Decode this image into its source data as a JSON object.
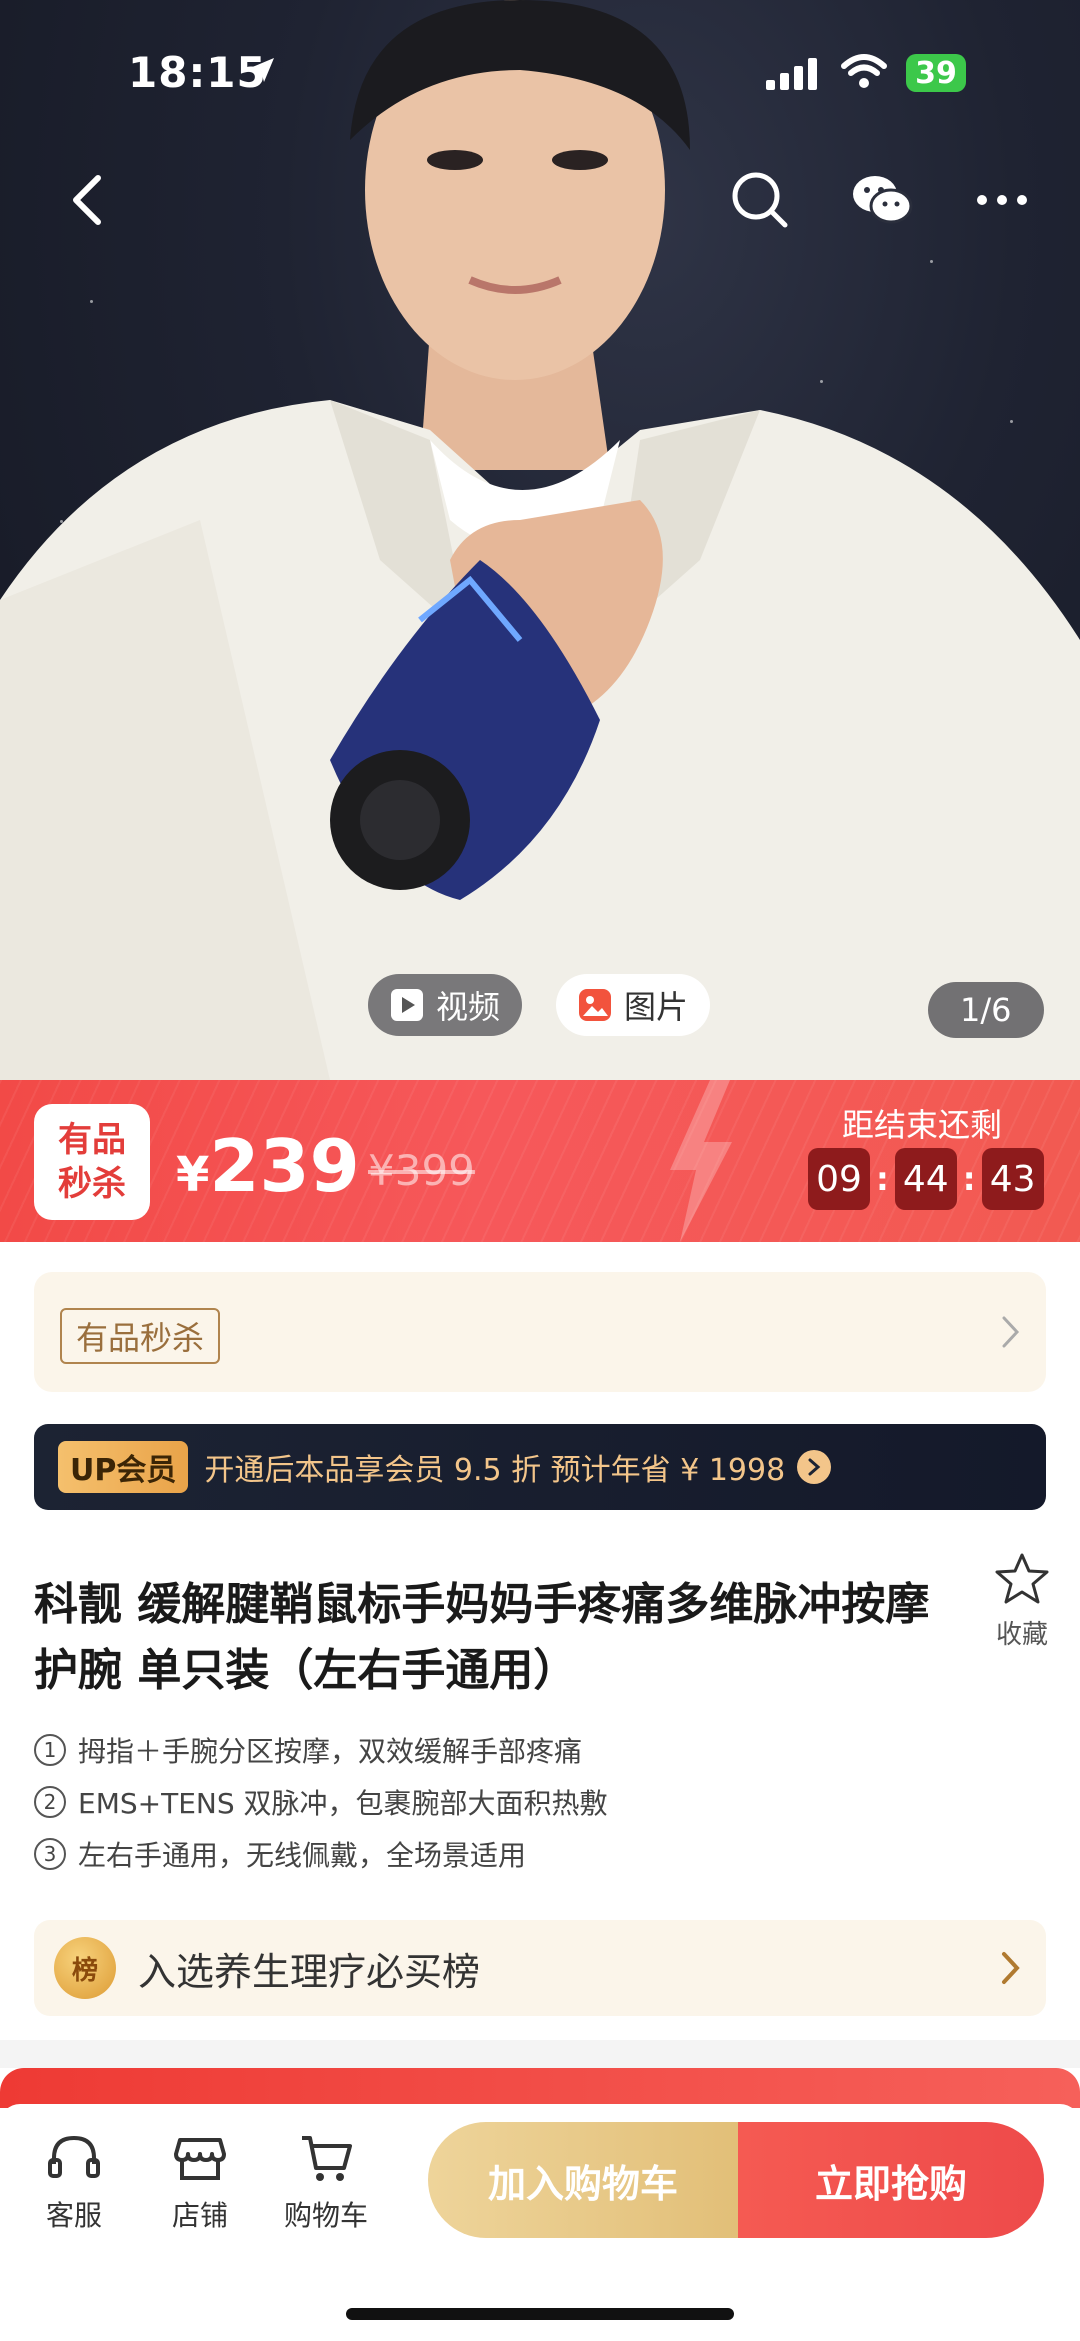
{
  "status_bar": {
    "time": "18:15",
    "battery": "39"
  },
  "media": {
    "tabs": [
      {
        "label": "视频",
        "icon": "play-icon"
      },
      {
        "label": "图片",
        "icon": "image-icon"
      }
    ],
    "page_indicator": "1/6"
  },
  "flash_sale": {
    "logo_line1": "有品",
    "logo_line2": "秒杀",
    "currency": "¥",
    "price": "239",
    "original_price": "¥399",
    "countdown_label": "距结束还剩",
    "countdown": {
      "hours": "09",
      "minutes": "44",
      "seconds": "43"
    },
    "colors": {
      "banner": "#f24a47",
      "countdown_box": "#8e1b1c"
    }
  },
  "youpin": {
    "tag": "有品秒杀"
  },
  "vip": {
    "badge": "UP会员",
    "text": "开通后本品享会员 9.5 折 预计年省 ¥ 1998"
  },
  "product": {
    "title": "科靓  缓解腱鞘鼠标手妈妈手疼痛多维脉冲按摩护腕 单只装（左右手通用）",
    "favorite_label": "收藏",
    "features": [
      {
        "num": "1",
        "text": "拇指＋手腕分区按摩，双效缓解手部疼痛"
      },
      {
        "num": "2",
        "text": "EMS+TENS 双脉冲，包裹腕部大面积热敷"
      },
      {
        "num": "3",
        "text": "左右手通用，无线佩戴，全场景适用"
      }
    ]
  },
  "ranking": {
    "medal": "榜",
    "text": "入选养生理疗必买榜"
  },
  "bottom_bar": {
    "service": "客服",
    "store": "店铺",
    "cart": "购物车",
    "add_to_cart": "加入购物车",
    "buy_now": "立即抢购",
    "colors": {
      "add_to_cart": "#e2bf78",
      "buy_now": "#ee4a4a"
    }
  }
}
